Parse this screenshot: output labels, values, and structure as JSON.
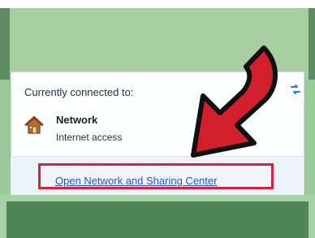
{
  "panel": {
    "heading": "Currently connected to:",
    "network_name": "Network",
    "network_status": "Internet access",
    "link_label": "Open Network and Sharing Center"
  },
  "icons": {
    "refresh": "refresh-icon",
    "network": "house-icon",
    "annotation": "red-arrow"
  },
  "colors": {
    "green_background": "#a7cfa2",
    "panel_bg": "#fbfdff",
    "link_blue": "#1f56c7",
    "highlight_red": "#d1243a"
  }
}
